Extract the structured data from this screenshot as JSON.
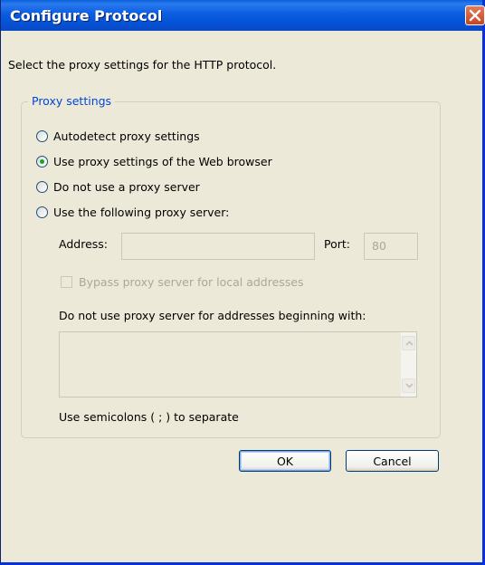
{
  "window": {
    "title": "Configure Protocol",
    "instruction": "Select the proxy settings for the HTTP protocol."
  },
  "proxy_settings": {
    "group_label": "Proxy settings",
    "options": [
      {
        "label": "Autodetect proxy settings",
        "checked": false
      },
      {
        "label": "Use proxy settings of the Web browser",
        "checked": true
      },
      {
        "label": "Do not use a proxy server",
        "checked": false
      },
      {
        "label": "Use the following proxy server:",
        "checked": false
      }
    ],
    "address_label": "Address:",
    "address_value": "",
    "port_label": "Port:",
    "port_value": "80",
    "bypass_label": "Bypass proxy server for local addresses",
    "exceptions_label": "Do not use proxy server for addresses beginning with:",
    "exceptions_value": "",
    "separator_hint": "Use semicolons ( ; ) to separate"
  },
  "buttons": {
    "ok": "OK",
    "cancel": "Cancel"
  },
  "colors": {
    "titlebar": "#0552d6",
    "dialog_bg": "#ece9d8",
    "group_label": "#0046d5",
    "disabled_text": "#aca899"
  },
  "icons": {
    "close": "close-x-icon",
    "scroll_up": "chevron-up-icon",
    "scroll_down": "chevron-down-icon"
  }
}
